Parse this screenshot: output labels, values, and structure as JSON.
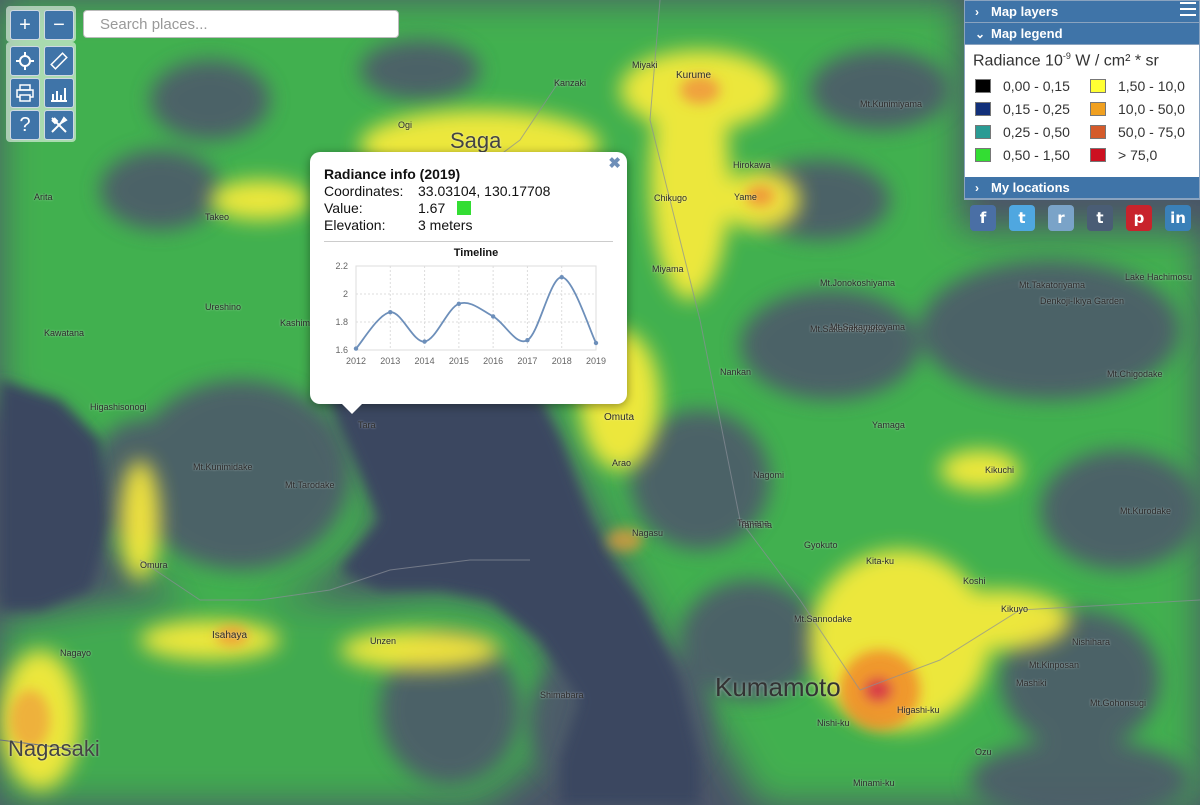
{
  "controls": {
    "zoom_in": "+",
    "zoom_out": "−",
    "locate_icon": "crosshair-icon",
    "measure_icon": "ruler-icon",
    "print_icon": "printer-icon",
    "stats_icon": "chart-icon",
    "help": "?",
    "tools_icon": "tools-icon"
  },
  "search": {
    "placeholder": "Search places..."
  },
  "panel": {
    "layers_label": "Map layers",
    "legend_label": "Map legend",
    "locations_label": "My locations",
    "legend_title_main": "Radiance 10",
    "legend_title_exp": "-9",
    "legend_title_rest": " W / cm² * sr",
    "legend_items": [
      {
        "label": "0,00 - 0,15",
        "color": "#000000"
      },
      {
        "label": "1,50 - 10,0",
        "color": "#ffff33"
      },
      {
        "label": "0,15 - 0,25",
        "color": "#12307a"
      },
      {
        "label": "10,0 - 50,0",
        "color": "#f0a020"
      },
      {
        "label": "0,25 - 0,50",
        "color": "#2a9b94"
      },
      {
        "label": "50,0 - 75,0",
        "color": "#d45a2a"
      },
      {
        "label": "0,50 - 1,50",
        "color": "#33dd33"
      },
      {
        "label": "> 75,0",
        "color": "#cc1020"
      }
    ]
  },
  "social": [
    {
      "name": "facebook-icon",
      "glyph": "f",
      "color": "#4a6fa5"
    },
    {
      "name": "twitter-icon",
      "glyph": "t",
      "color": "#4fa7e0"
    },
    {
      "name": "reddit-icon",
      "glyph": "r",
      "color": "#7aa3c8"
    },
    {
      "name": "tumblr-icon",
      "glyph": "t",
      "color": "#4a5d75"
    },
    {
      "name": "pinterest-icon",
      "glyph": "p",
      "color": "#c8232c"
    },
    {
      "name": "linkedin-icon",
      "glyph": "in",
      "color": "#3a80b8"
    }
  ],
  "popup": {
    "title": "Radiance info (2019)",
    "coordinates_label": "Coordinates:",
    "coordinates_value": "33.03104, 130.17708",
    "value_label": "Value:",
    "value_value": "1.67",
    "value_color": "#33dd33",
    "elevation_label": "Elevation:",
    "elevation_value": "3 meters"
  },
  "chart_data": {
    "type": "line",
    "title": "Timeline",
    "x": [
      "2012",
      "2013",
      "2014",
      "2015",
      "2016",
      "2017",
      "2018",
      "2019"
    ],
    "series": [
      {
        "values": [
          1.61,
          1.87,
          1.66,
          1.93,
          1.84,
          1.67,
          2.12,
          1.65
        ]
      }
    ],
    "ylim": [
      1.6,
      2.2
    ],
    "yticks": [
      "2.2",
      "2",
      "1.8",
      "1.6"
    ],
    "grid": true
  },
  "map_labels": [
    {
      "text": "Saga",
      "cls": "big"
    },
    {
      "text": "Kumamoto",
      "cls": "city"
    },
    {
      "text": "Nagasaki",
      "cls": "big"
    },
    {
      "text": "Kurume",
      "cls": "mid"
    },
    {
      "text": "Omuta",
      "cls": "mid"
    },
    {
      "text": "Isahaya",
      "cls": "mid"
    },
    {
      "text": "Ureshino",
      "cls": ""
    },
    {
      "text": "Kashima",
      "cls": ""
    },
    {
      "text": "Takeo",
      "cls": ""
    },
    {
      "text": "Arita",
      "cls": ""
    },
    {
      "text": "Kawatana",
      "cls": ""
    },
    {
      "text": "Omura",
      "cls": ""
    },
    {
      "text": "Nagayo",
      "cls": ""
    },
    {
      "text": "Unzen",
      "cls": ""
    },
    {
      "text": "Shimabara",
      "cls": ""
    },
    {
      "text": "Tara",
      "cls": ""
    },
    {
      "text": "Arao",
      "cls": ""
    },
    {
      "text": "Nagasu",
      "cls": ""
    },
    {
      "text": "Tamana",
      "cls": ""
    },
    {
      "text": "Gyokuto",
      "cls": ""
    },
    {
      "text": "Kita-ku",
      "cls": ""
    },
    {
      "text": "Koshi",
      "cls": ""
    },
    {
      "text": "Kikuchi",
      "cls": ""
    },
    {
      "text": "Yamaga",
      "cls": ""
    },
    {
      "text": "Nankan",
      "cls": ""
    },
    {
      "text": "Nagomi",
      "cls": ""
    },
    {
      "text": "Miyama",
      "cls": ""
    },
    {
      "text": "Chikugo",
      "cls": ""
    },
    {
      "text": "Yame",
      "cls": ""
    },
    {
      "text": "Hirokawa",
      "cls": ""
    },
    {
      "text": "Miyaki",
      "cls": ""
    },
    {
      "text": "Kanzaki",
      "cls": ""
    },
    {
      "text": "Ogi",
      "cls": ""
    },
    {
      "text": "Kikuyo",
      "cls": ""
    },
    {
      "text": "Higashi-ku",
      "cls": ""
    },
    {
      "text": "Nishi-ku",
      "cls": ""
    },
    {
      "text": "Minami-ku",
      "cls": ""
    },
    {
      "text": "Mashiki",
      "cls": ""
    },
    {
      "text": "Nishihara",
      "cls": ""
    },
    {
      "text": "Ozu",
      "cls": ""
    },
    {
      "text": "Tachiarai",
      "cls": ""
    },
    {
      "text": "Mt.Kurodake",
      "cls": ""
    },
    {
      "text": "Mt.Tarodake",
      "cls": ""
    },
    {
      "text": "Mt.Kunimidake",
      "cls": ""
    },
    {
      "text": "Mt.Chigodake",
      "cls": ""
    },
    {
      "text": "Mt.Sannodake",
      "cls": ""
    },
    {
      "text": "Mt.Kinposan",
      "cls": ""
    },
    {
      "text": "Mt.Gohonsugi",
      "cls": ""
    },
    {
      "text": "Mt.Sakamotoyama",
      "cls": ""
    },
    {
      "text": "Mt.Jonokoshiyama",
      "cls": ""
    },
    {
      "text": "Mt.Takatoriyama",
      "cls": ""
    },
    {
      "text": "Mt.Kunimiyama",
      "cls": ""
    },
    {
      "text": "Mt.Sakamotoyama",
      "cls": ""
    },
    {
      "text": "Higashisonogi",
      "cls": ""
    },
    {
      "text": "Lake Hachimosu",
      "cls": ""
    },
    {
      "text": "Denkoji-Ikiya Garden",
      "cls": ""
    },
    {
      "text": "Tamana",
      "cls": ""
    }
  ]
}
